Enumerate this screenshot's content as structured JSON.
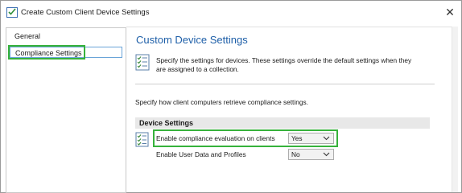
{
  "window": {
    "title": "Create Custom Client Device Settings",
    "close_glyph": "✕",
    "app_icon": "checklist-window-icon"
  },
  "nav": {
    "items": [
      {
        "label": "General",
        "selected": false
      },
      {
        "label": "Compliance Settings",
        "selected": true
      }
    ]
  },
  "main": {
    "heading": "Custom Device Settings",
    "heading_color": "#1e5fa8",
    "description": "Specify the settings for devices. These settings override the default settings when they are assigned to a collection.",
    "specify_text": "Specify how client computers retrieve compliance settings.",
    "group_title": "Device Settings",
    "settings": [
      {
        "label": "Enable compliance evaluation on clients",
        "value": "Yes",
        "highlighted": true
      },
      {
        "label": "Enable User Data and Profiles",
        "value": "No",
        "highlighted": false
      }
    ]
  },
  "colors": {
    "highlight": "#36b23b",
    "nav_selection_border": "#6aa4d8",
    "group_header_bg": "#e8e8e8"
  },
  "icons": [
    "checklist-window-icon",
    "close-icon",
    "settings-checklist-icon",
    "chevron-down-icon"
  ]
}
